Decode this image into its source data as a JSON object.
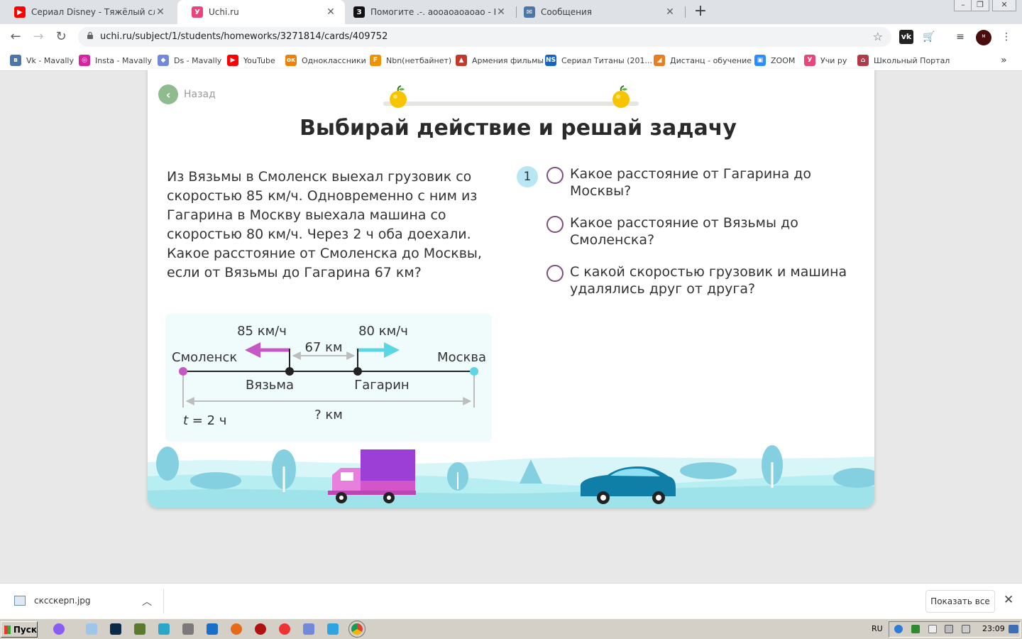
{
  "browser": {
    "tabs": [
      {
        "title": "Сериал Disney - Тяжёлый случай (",
        "icon": "youtube-icon",
        "color": "#ff0000",
        "active": false
      },
      {
        "title": "Uchi.ru",
        "icon": "uchi-icon",
        "color": "#e9457a",
        "active": true
      },
      {
        "title": "Помогите .-. аооаоаоаоао - Школь",
        "icon": "znanija-icon",
        "color": "#111111",
        "active": false
      },
      {
        "title": "Сообщения",
        "icon": "messages-icon",
        "color": "#4a76a8",
        "active": false
      }
    ],
    "new_tab": "+",
    "window_controls": [
      "–",
      "❐",
      "✕"
    ],
    "url": "uchi.ru/subject/1/students/homeworks/3271814/cards/409752",
    "bookmarks": [
      {
        "label": "Vk - Mavally",
        "icon": "vk-icon",
        "color": "#4a76a8",
        "glyph": "в"
      },
      {
        "label": "Insta - Mavally",
        "icon": "instagram-icon",
        "color": "#d6249f",
        "glyph": "◎"
      },
      {
        "label": "Ds - Mavally",
        "icon": "discord-icon",
        "color": "#7289da",
        "glyph": "◆"
      },
      {
        "label": "YouTube",
        "icon": "youtube-icon",
        "color": "#ff0000",
        "glyph": "▶"
      },
      {
        "label": "Одноклассники",
        "icon": "ok-icon",
        "color": "#ee8208",
        "glyph": "ок"
      },
      {
        "label": "Nbn(нетбайнет)",
        "icon": "nbn-icon",
        "color": "#f29100",
        "glyph": "F"
      },
      {
        "label": "Армения фильмы",
        "icon": "armenia-icon",
        "color": "#c0392b",
        "glyph": "▲"
      },
      {
        "label": "Сериал Титаны (201...",
        "icon": "ns-icon",
        "color": "#1565c0",
        "glyph": "NS"
      },
      {
        "label": "Дистанц - обучение",
        "icon": "fox-icon",
        "color": "#e67e22",
        "glyph": "◢"
      },
      {
        "label": "ZOOM",
        "icon": "zoom-icon",
        "color": "#2d8cff",
        "glyph": "▣"
      },
      {
        "label": "Учи ру",
        "icon": "uchi-icon",
        "color": "#e9457a",
        "glyph": "У"
      },
      {
        "label": "Школьный Портал",
        "icon": "portal-icon",
        "color": "#b23a48",
        "glyph": "⌂"
      }
    ],
    "bookmarks_more": "»"
  },
  "page": {
    "back_label": "Назад",
    "title": "Выбирай действие и решай задачу",
    "problem": "Из Вязьмы в Смоленск выехал грузовик со скоростью 85 км/ч. Одновременно с ним из Гагарина в Москву выехала машина со скоростью 80 км/ч. Через 2 ч оба доехали. Какое расстояние от Смоленска до Москвы, если от Вязьмы до Гагарина 67 км?",
    "question_number": "1",
    "options": [
      "Какое расстояние от Гагарина до Москвы?",
      "Какое расстояние от Вязьмы до Смоленска?",
      "С какой скоростью грузовик и машина удалялись друг от друга?"
    ],
    "diagram": {
      "speed_left": "85 км/ч",
      "speed_right": "80 км/ч",
      "distance_middle": "67 км",
      "city_left": "Смоленск",
      "city_right": "Москва",
      "city_mid_left": "Вязьма",
      "city_mid_right": "Гагарин",
      "time_var": "t",
      "time_value": " = 2 ч",
      "total_label": "? км"
    },
    "colors": {
      "accent_pink": "#c558c4",
      "accent_cyan": "#5dd6e4",
      "radio_border": "#7b4f7a",
      "badge": "#b8e6f2"
    }
  },
  "downloads": {
    "file": "сксскерп.jpg",
    "show_all": "Показать все"
  },
  "taskbar": {
    "start": "Пуск",
    "lang": "RU",
    "clock": "23:09"
  }
}
